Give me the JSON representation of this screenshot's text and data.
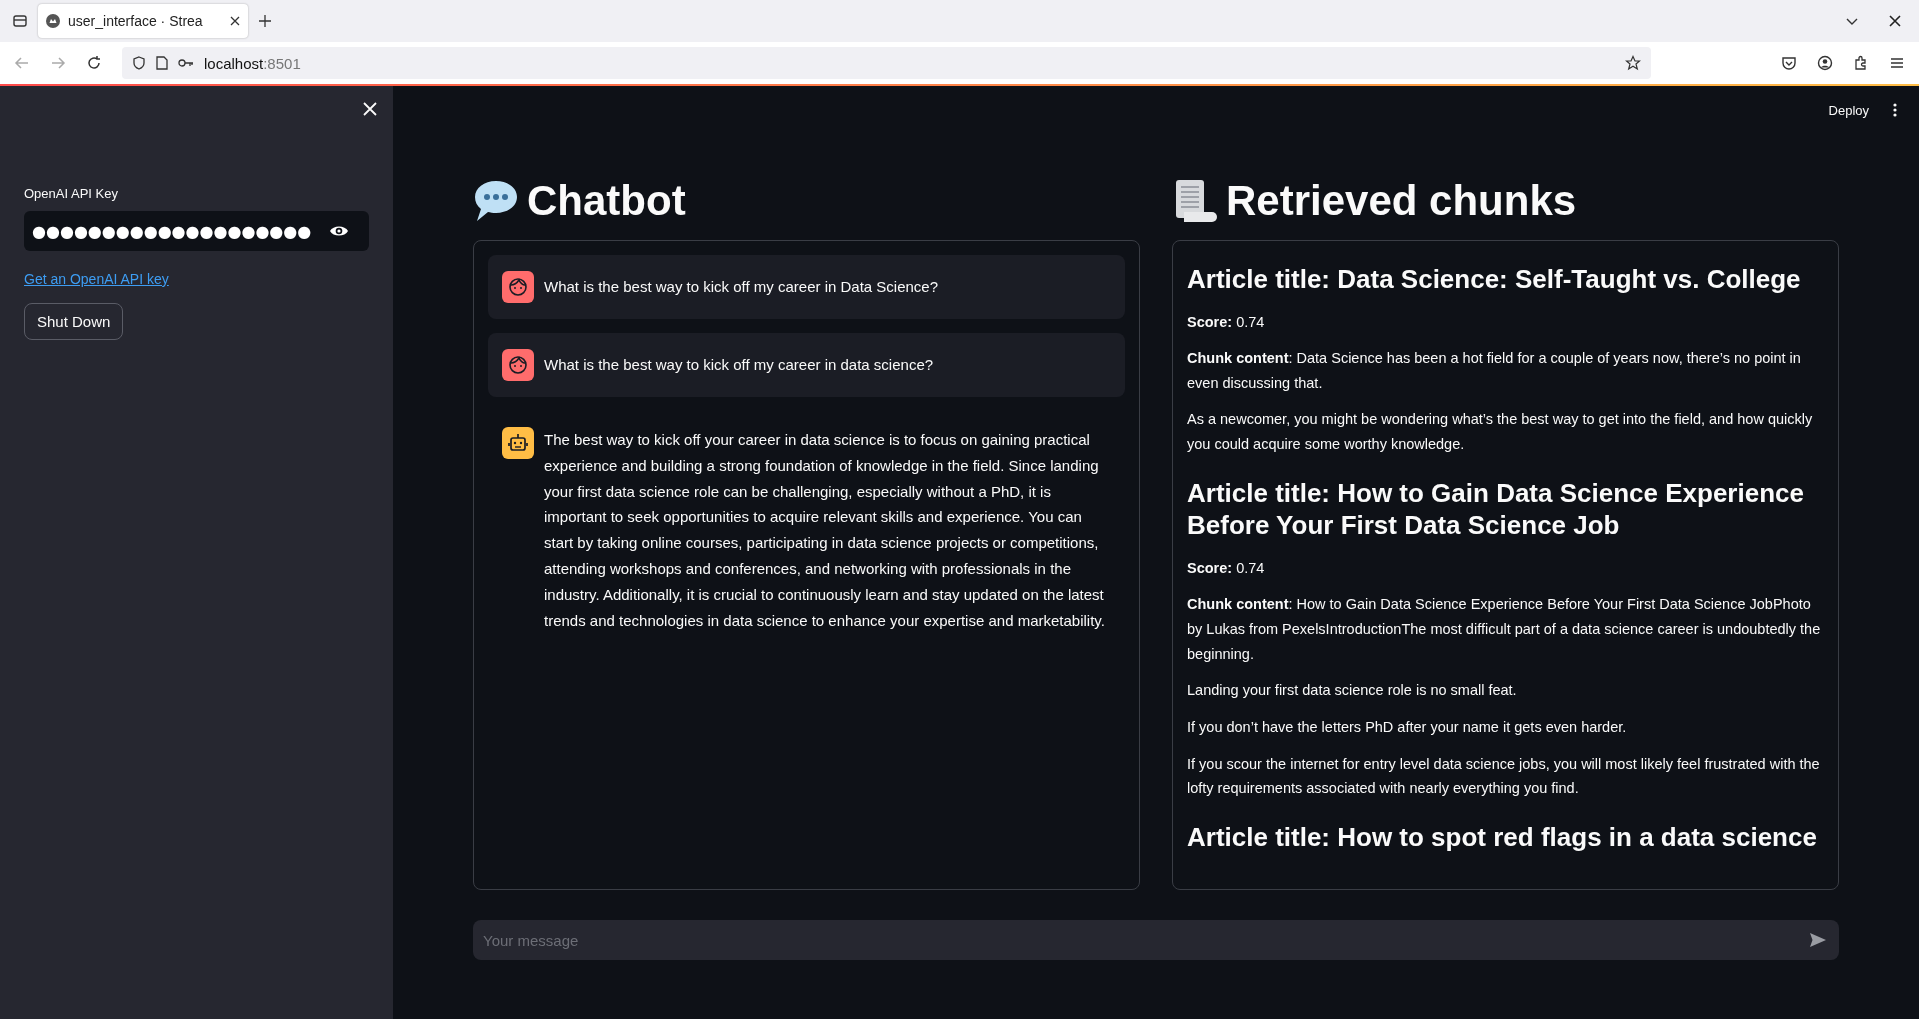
{
  "browser": {
    "tab_title": "user_interface · Strea",
    "url_host": "localhost",
    "url_port": ":8501"
  },
  "sidebar": {
    "api_key": {
      "label": "OpenAI API Key",
      "masked_value": "●●●●●●●●●●●●●●●●●●●●"
    },
    "link": "Get an OpenAI API key",
    "button": "Shut Down"
  },
  "header": {
    "deploy": "Deploy"
  },
  "chat": {
    "title": "Chatbot",
    "messages": [
      {
        "kind": "user",
        "text": "What is the best way to kick off my career in Data Science?"
      },
      {
        "kind": "user",
        "text": "What is the best way to kick off my career in data science?"
      },
      {
        "kind": "assistant",
        "text": "The best way to kick off your career in data science is to focus on gaining practical experience and building a strong foundation of knowledge in the field. Since landing your first data science role can be challenging, especially without a PhD, it is important to seek opportunities to acquire relevant skills and experience. You can start by taking online courses, participating in data science projects or competitions, attending workshops and conferences, and networking with professionals in the industry. Additionally, it is crucial to continuously learn and stay updated on the latest trends and technologies in data science to enhance your expertise and marketability."
      }
    ]
  },
  "chunks": {
    "title": "Retrieved chunks",
    "articles": [
      {
        "title": "Article title: Data Science: Self-Taught vs. College",
        "paragraphs": [
          "**Score:** 0.74",
          "**Chunk content**: Data Science has been a hot field for a couple of years now, there’s no point in even discussing that.",
          "As a newcomer, you might be wondering what’s the best way to get into the field, and how quickly you could acquire some worthy knowledge."
        ]
      },
      {
        "title": "Article title: How to Gain Data Science Experience Before Your First Data Science Job",
        "paragraphs": [
          "**Score:** 0.74",
          "**Chunk content**: How to Gain Data Science Experience Before Your First Data Science JobPhoto by Lukas from PexelsIntroductionThe most difficult part of a data science career is undoubtedly the beginning.",
          "Landing your first data science role is no small feat.",
          "If you don’t have the letters PhD after your name it gets even harder.",
          "If you scour the internet for entry level data science jobs, you will most likely feel frustrated with the lofty requirements associated with nearly everything you find."
        ]
      },
      {
        "title": "Article title: How to spot red flags in a data science"
      }
    ]
  },
  "chat_input": {
    "placeholder": "Your message"
  }
}
